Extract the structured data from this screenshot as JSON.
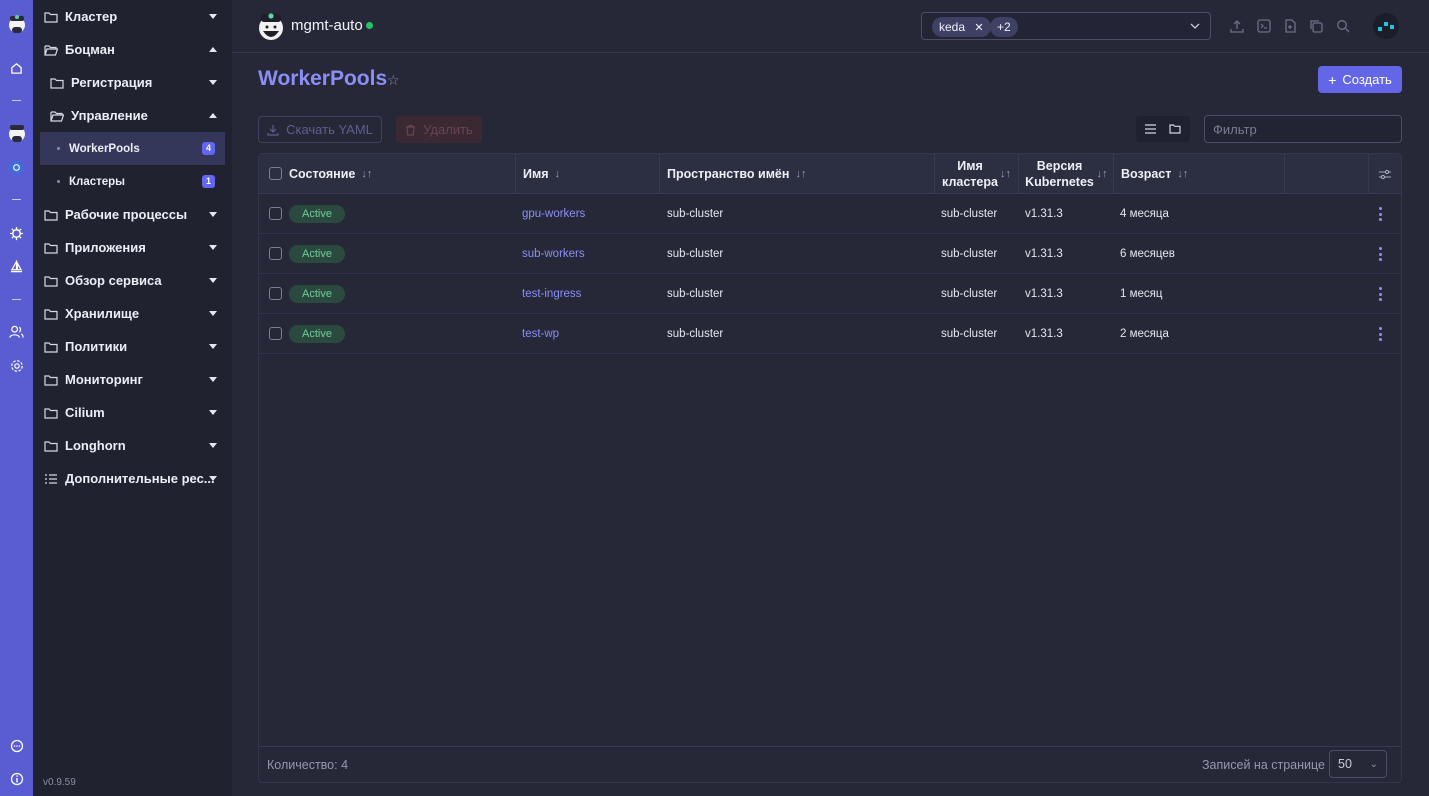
{
  "app": {
    "version": "v0.9.59",
    "cluster_name": "mgmt-auto",
    "status_color": "#22c55e",
    "accent_color": "#6466e8"
  },
  "sidebar": {
    "groups": [
      {
        "label": "Кластер",
        "icon": "folder-icon",
        "expanded": false
      },
      {
        "label": "Боцман",
        "icon": "folder-open-icon",
        "expanded": true
      },
      {
        "label": "Регистрация",
        "icon": "folder-icon",
        "expanded": false
      },
      {
        "label": "Управление",
        "icon": "folder-open-icon",
        "expanded": true
      },
      {
        "label": "Рабочие процессы",
        "icon": "folder-icon",
        "expanded": false
      },
      {
        "label": "Приложения",
        "icon": "folder-icon",
        "expanded": false
      },
      {
        "label": "Обзор сервиса",
        "icon": "folder-icon",
        "expanded": false
      },
      {
        "label": "Хранилище",
        "icon": "folder-icon",
        "expanded": false
      },
      {
        "label": "Политики",
        "icon": "folder-icon",
        "expanded": false
      },
      {
        "label": "Мониторинг",
        "icon": "folder-icon",
        "expanded": false
      },
      {
        "label": "Cilium",
        "icon": "folder-icon",
        "expanded": false
      },
      {
        "label": "Longhorn",
        "icon": "folder-icon",
        "expanded": false
      },
      {
        "label": "Дополнительные рес...",
        "icon": "list-icon",
        "expanded": false
      }
    ],
    "leaves": [
      {
        "label": "WorkerPools",
        "count": "4",
        "active": true
      },
      {
        "label": "Кластеры",
        "count": "1",
        "active": false
      }
    ]
  },
  "header": {
    "namespace_chips": [
      "keda",
      "+2"
    ]
  },
  "page": {
    "title": "WorkerPools",
    "create_label": "Создать",
    "download_yaml_label": "Скачать YAML",
    "delete_label": "Удалить",
    "filter_placeholder": "Фильтр"
  },
  "table": {
    "columns": [
      "Состояние",
      "Имя",
      "Пространство имён",
      "Имя кластера",
      "Версия Kubernetes",
      "Возраст"
    ],
    "rows": [
      {
        "status": "Active",
        "name": "gpu-workers",
        "namespace": "sub-cluster",
        "cluster": "sub-cluster",
        "version": "v1.31.3",
        "age": "4 месяца"
      },
      {
        "status": "Active",
        "name": "sub-workers",
        "namespace": "sub-cluster",
        "cluster": "sub-cluster",
        "version": "v1.31.3",
        "age": "6 месяцев"
      },
      {
        "status": "Active",
        "name": "test-ingress",
        "namespace": "sub-cluster",
        "cluster": "sub-cluster",
        "version": "v1.31.3",
        "age": "1 месяц"
      },
      {
        "status": "Active",
        "name": "test-wp",
        "namespace": "sub-cluster",
        "cluster": "sub-cluster",
        "version": "v1.31.3",
        "age": "2 месяца"
      }
    ],
    "footer": {
      "count_label": "Количество: 4",
      "per_page_label": "Записей на странице",
      "per_page_value": "50"
    }
  }
}
